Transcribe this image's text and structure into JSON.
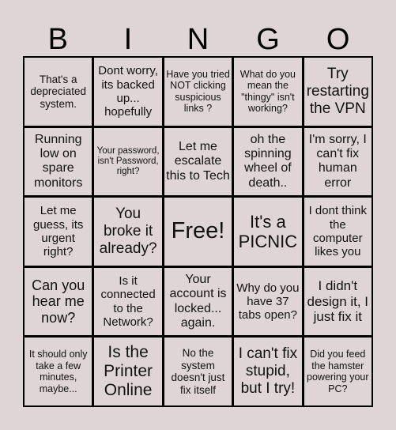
{
  "header": [
    "B",
    "I",
    "N",
    "G",
    "O"
  ],
  "cells": [
    "That's a depreciated system.",
    "Dont worry, its backed up... hopefully",
    "Have you tried NOT clicking suspicious links ?",
    "What do you mean the \"thingy\" isn't working?",
    "Try restarting the VPN",
    "Running low on spare monitors",
    "Your password, isn't Password, right?",
    "Let me escalate this to Tech",
    "oh the spinning wheel of death..",
    "I'm sorry, I can't fix human error",
    "Let me guess, its urgent right?",
    "You broke it already?",
    "Free!",
    "It's a PICNIC",
    "I dont think the computer likes you",
    "Can you hear me now?",
    "Is it connected to the Network?",
    "Your account is locked... again.",
    "Why do you have 37 tabs open?",
    "I didn't design it, I just fix it",
    "It should only take a few minutes, maybe...",
    "Is the Printer Online",
    "No the system doesn't just fix itself",
    "I can't fix stupid, but I try!",
    "Did you feed the hamster powering your PC?"
  ]
}
